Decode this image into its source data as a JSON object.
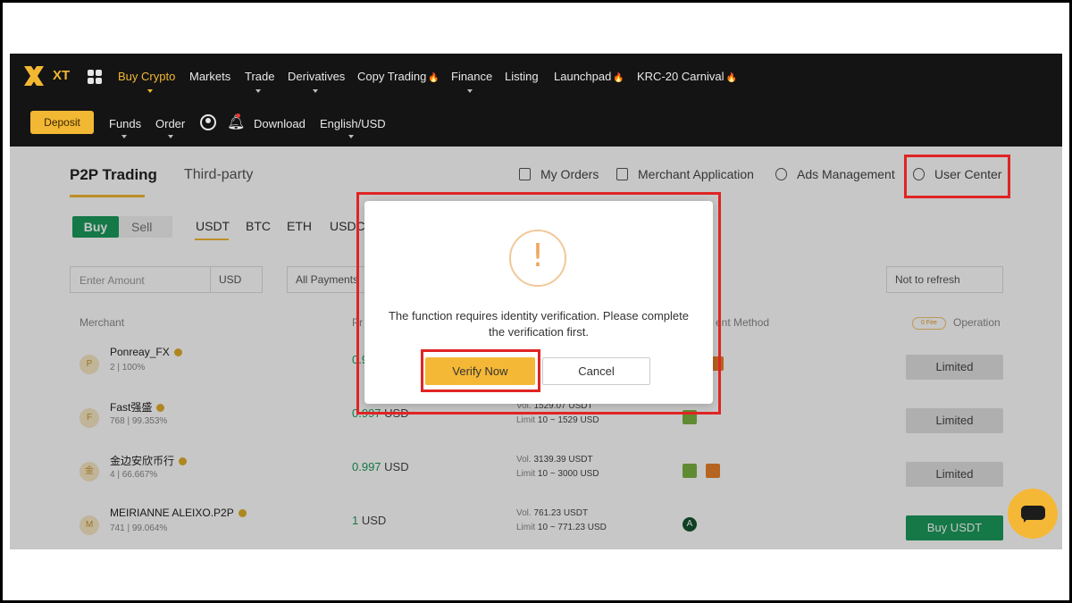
{
  "header": {
    "logo_text": "XT",
    "nav": [
      {
        "label": "Buy Crypto",
        "active": true
      },
      {
        "label": "Markets"
      },
      {
        "label": "Trade"
      },
      {
        "label": "Derivatives"
      },
      {
        "label": "Copy Trading",
        "hot": true
      },
      {
        "label": "Finance"
      },
      {
        "label": "Listing"
      },
      {
        "label": "Launchpad",
        "hot": true
      },
      {
        "label": "KRC-20 Carnival",
        "hot": true
      }
    ],
    "deposit_label": "Deposit",
    "funds_label": "Funds",
    "order_label": "Order",
    "download_label": "Download",
    "language_label": "English/USD"
  },
  "p2p": {
    "title": "P2P Trading",
    "third_party": "Third-party",
    "links": {
      "my_orders": "My Orders",
      "merchant_application": "Merchant Application",
      "ads_management": "Ads Management",
      "user_center": "User Center"
    },
    "buy_label": "Buy",
    "sell_label": "Sell",
    "coins": [
      "USDT",
      "BTC",
      "ETH",
      "USDC"
    ],
    "amount_placeholder": "Enter Amount",
    "amount_currency": "USD",
    "payment_filter": "All Payments",
    "refresh_option": "Not to refresh",
    "columns": {
      "merchant": "Merchant",
      "price": "Pr",
      "payment_method": "ent Method",
      "fee_badge": "0 Fee",
      "operation": "Operation"
    },
    "rows": [
      {
        "avatar": "P",
        "name": "Ponreay_FX",
        "stats": "2 | 100%",
        "price": "0.9",
        "price_unit": "",
        "vol": "",
        "limit": "",
        "operation": "Limited"
      },
      {
        "avatar": "F",
        "name": "Fast强盛",
        "stats": "768 | 99.353%",
        "price": "0.997",
        "price_unit": "USD",
        "vol_label": "Vol.",
        "vol": "1529.07 USDT",
        "limit_label": "Limit",
        "limit": "10 ~ 1529 USD",
        "operation": "Limited"
      },
      {
        "avatar": "金",
        "name": "金边安欣币行",
        "stats": "4 | 66.667%",
        "price": "0.997",
        "price_unit": "USD",
        "vol_label": "Vol.",
        "vol": "3139.39 USDT",
        "limit_label": "Limit",
        "limit": "10 ~ 3000 USD",
        "operation": "Limited"
      },
      {
        "avatar": "M",
        "name": "MEIRIANNE ALEIXO.P2P",
        "stats": "741 | 99.064%",
        "price": "1",
        "price_unit": "USD",
        "vol_label": "Vol.",
        "vol": "761.23 USDT",
        "limit_label": "Limit",
        "limit": "10 ~ 771.23 USD",
        "operation": "Buy USDT"
      }
    ]
  },
  "modal": {
    "icon": "!",
    "message": "The function requires identity verification. Please complete the verification first.",
    "verify_label": "Verify Now",
    "cancel_label": "Cancel"
  },
  "colors": {
    "accent": "#f2b733",
    "buy_green": "#1a9a5c",
    "annotation_red": "#e02424",
    "header_bg": "#141414"
  }
}
